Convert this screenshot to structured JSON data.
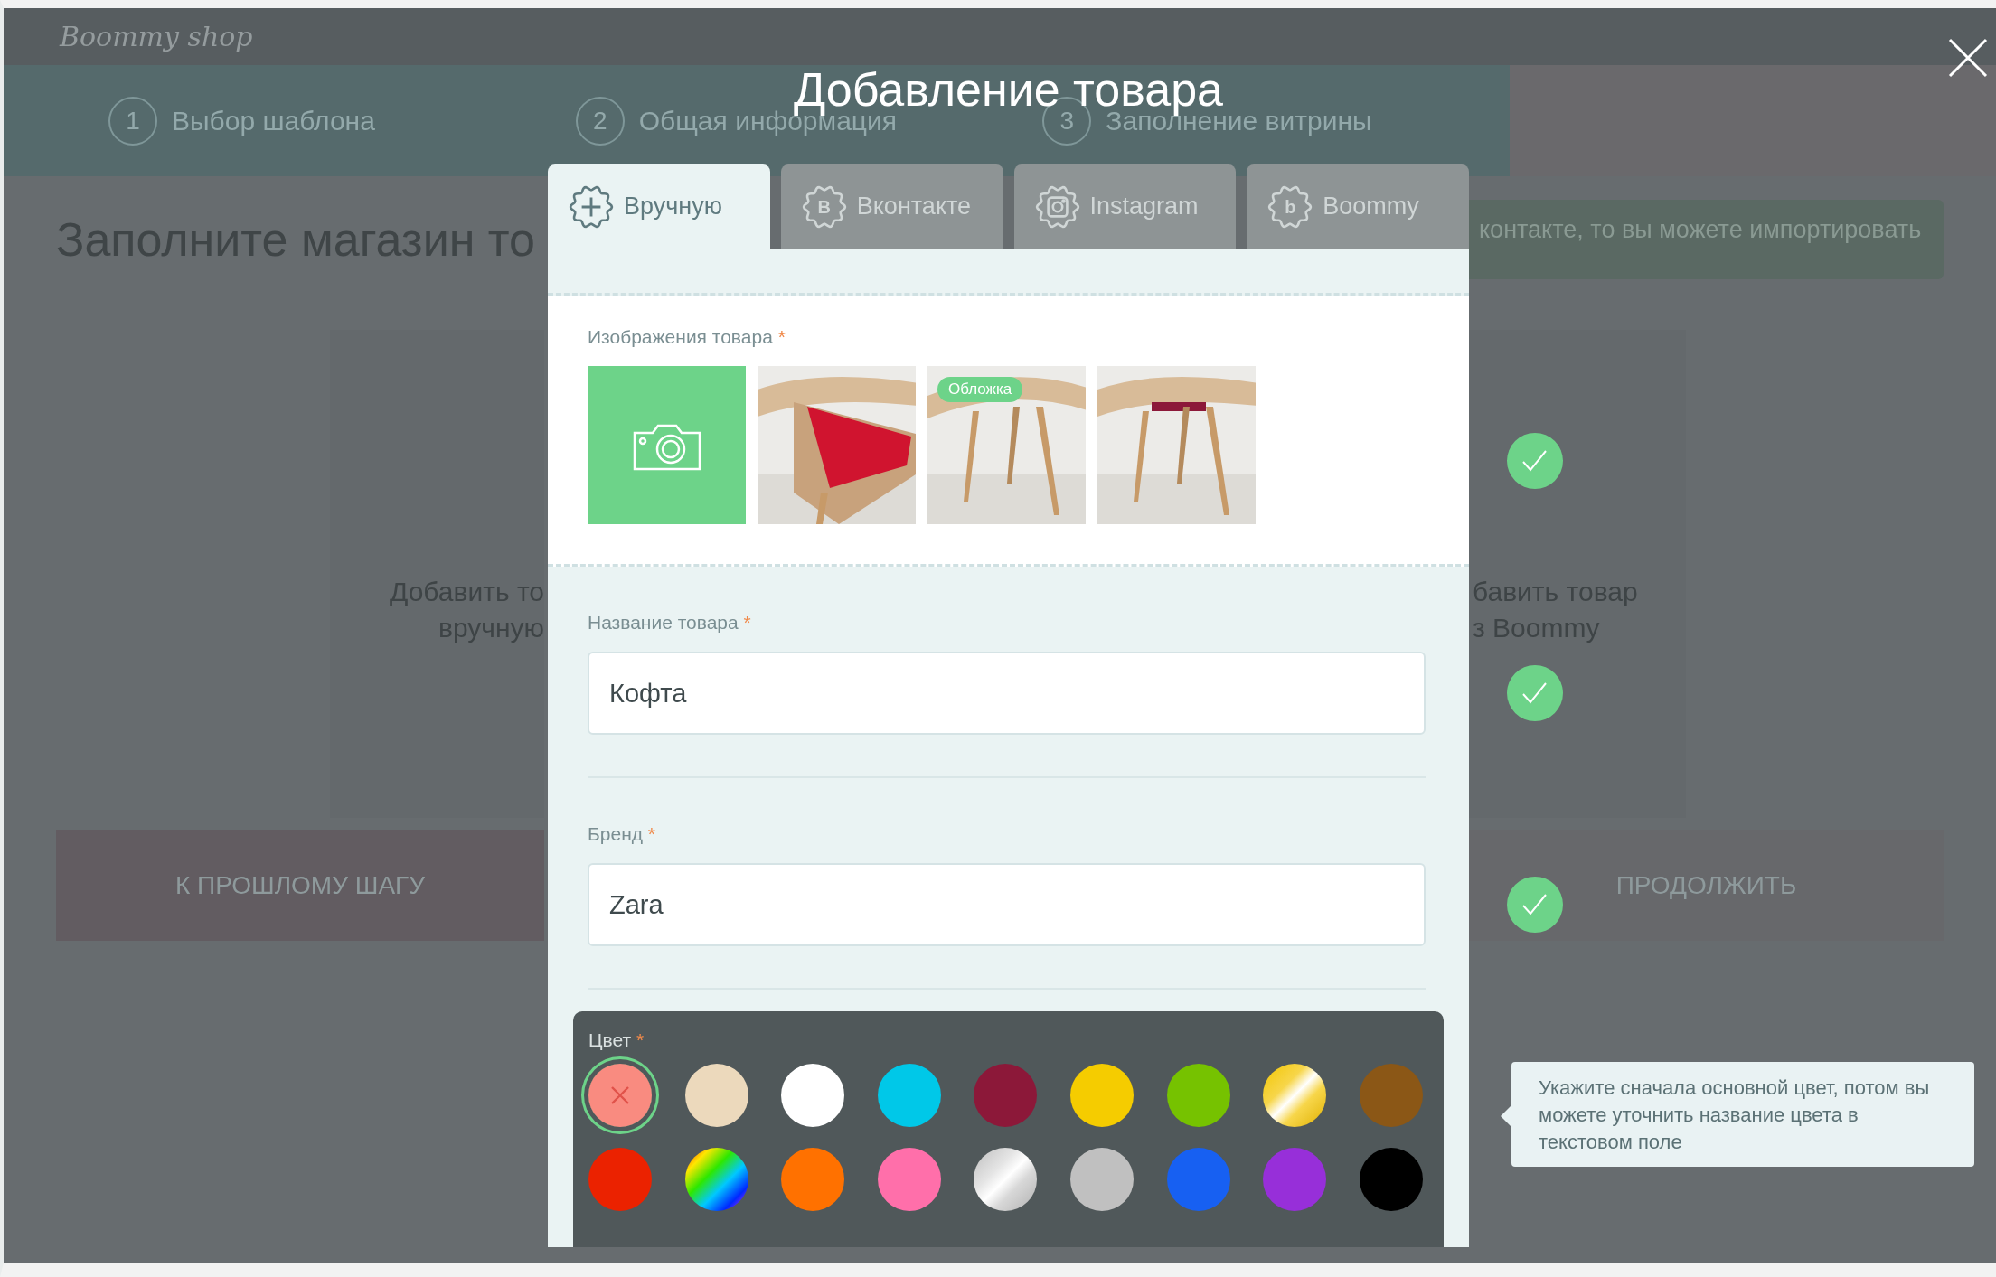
{
  "background_page": {
    "logo": "Boommy shop",
    "steps": [
      {
        "number": "1",
        "label": "Выбор шаблона"
      },
      {
        "number": "2",
        "label": "Общая информация"
      },
      {
        "number": "3",
        "label": "Заполнение витрины"
      }
    ],
    "title": "Заполните магазин то",
    "banner": "контакте, то вы можете импортировать",
    "cards": [
      {
        "lines": [
          "Добавить то",
          "вручную"
        ]
      },
      {
        "lines": [
          "бавить товар",
          "з Boommy"
        ]
      }
    ],
    "buttons": [
      "К ПРОШЛОМУ ШАГУ",
      "ПРОДОЛЖИТЬ"
    ]
  },
  "modal": {
    "title": "Добавление товара",
    "tabs": [
      {
        "label": "Вручную",
        "kind": "plus",
        "selected": true
      },
      {
        "label": "Вконтакте",
        "kind": "letter",
        "glyph": "B",
        "selected": false
      },
      {
        "label": "Instagram",
        "kind": "camera",
        "selected": false
      },
      {
        "label": "Boommy",
        "kind": "letter",
        "glyph": "b",
        "selected": false
      }
    ],
    "images": {
      "label": "Изображения товара",
      "required_mark": "*",
      "valid": true,
      "items": [
        {
          "kind": "upload"
        },
        {
          "kind": "picture"
        },
        {
          "kind": "picture",
          "badge": "Обложка"
        },
        {
          "kind": "picture"
        }
      ]
    },
    "fields": [
      {
        "label": "Название товара",
        "required_mark": "*",
        "value": "Кофта",
        "valid": true
      },
      {
        "label": "Бренд",
        "required_mark": "*",
        "value": "Zara",
        "valid": true
      }
    ],
    "color": {
      "label": "Цвет",
      "required_mark": "*",
      "swatches": [
        {
          "kind": "solid",
          "color": "#f98b80",
          "selected": true
        },
        {
          "kind": "solid",
          "color": "#ecd9bc",
          "selected": false
        },
        {
          "kind": "solid",
          "color": "#ffffff",
          "selected": false
        },
        {
          "kind": "solid",
          "color": "#00c8e8",
          "selected": false
        },
        {
          "kind": "solid",
          "color": "#8c1839",
          "selected": false
        },
        {
          "kind": "solid",
          "color": "#f5cc00",
          "selected": false
        },
        {
          "kind": "solid",
          "color": "#76c200",
          "selected": false
        },
        {
          "kind": "gold",
          "selected": false
        },
        {
          "kind": "solid",
          "color": "#8b5716",
          "selected": false
        },
        {
          "kind": "solid",
          "color": "#eb2200",
          "selected": false
        },
        {
          "kind": "rainbow",
          "selected": false
        },
        {
          "kind": "solid",
          "color": "#ff7100",
          "selected": false
        },
        {
          "kind": "solid",
          "color": "#ff6faa",
          "selected": false
        },
        {
          "kind": "silver",
          "selected": false
        },
        {
          "kind": "solid",
          "color": "#c0c0c0",
          "selected": false
        },
        {
          "kind": "solid",
          "color": "#1760f2",
          "selected": false
        },
        {
          "kind": "solid",
          "color": "#972fd9",
          "selected": false
        },
        {
          "kind": "solid",
          "color": "#000000",
          "selected": false
        }
      ]
    },
    "tooltip": "Укажите сначала основной цвет, потом вы можете уточнить название цвета в текстовом поле"
  }
}
